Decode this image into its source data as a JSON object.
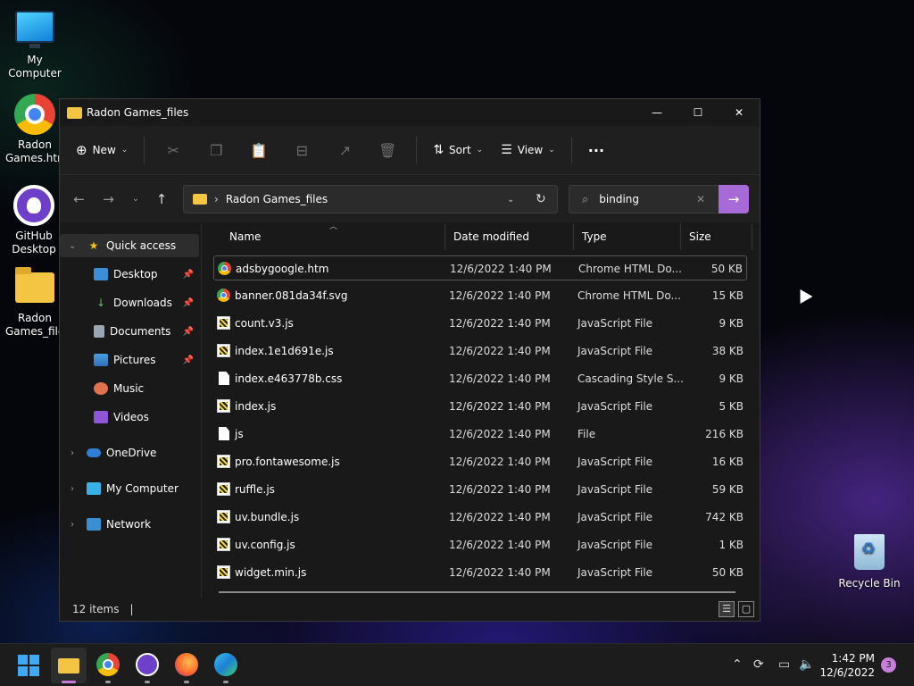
{
  "desktop": {
    "icons": [
      {
        "label": "My Computer"
      },
      {
        "label": "Radon Games.htm"
      },
      {
        "label": "GitHub Desktop"
      },
      {
        "label": "Radon Games_files"
      },
      {
        "label": "Recycle Bin"
      }
    ]
  },
  "window": {
    "title": "Radon Games_files",
    "controls": {
      "minimize": "—",
      "maximize": "☐",
      "close": "✕"
    },
    "toolbar": {
      "new_label": "New",
      "sort_label": "Sort",
      "view_label": "View",
      "more_label": "···"
    },
    "address": {
      "path": "Radon Games_files",
      "separator": "›"
    },
    "search": {
      "value": "binding"
    },
    "sidebar": {
      "quick_access": "Quick access",
      "items": [
        {
          "label": "Desktop",
          "pinned": true
        },
        {
          "label": "Downloads",
          "pinned": true
        },
        {
          "label": "Documents",
          "pinned": true
        },
        {
          "label": "Pictures",
          "pinned": true
        },
        {
          "label": "Music",
          "pinned": false
        },
        {
          "label": "Videos",
          "pinned": false
        }
      ],
      "roots": [
        {
          "label": "OneDrive"
        },
        {
          "label": "My Computer"
        },
        {
          "label": "Network"
        }
      ]
    },
    "columns": {
      "name": "Name",
      "date": "Date modified",
      "type": "Type",
      "size": "Size"
    },
    "files": [
      {
        "name": "adsbygoogle.htm",
        "date": "12/6/2022 1:40 PM",
        "type": "Chrome HTML Do...",
        "size": "50 KB",
        "icon": "chrome"
      },
      {
        "name": "banner.081da34f.svg",
        "date": "12/6/2022 1:40 PM",
        "type": "Chrome HTML Do...",
        "size": "15 KB",
        "icon": "chrome"
      },
      {
        "name": "count.v3.js",
        "date": "12/6/2022 1:40 PM",
        "type": "JavaScript File",
        "size": "9 KB",
        "icon": "js"
      },
      {
        "name": "index.1e1d691e.js",
        "date": "12/6/2022 1:40 PM",
        "type": "JavaScript File",
        "size": "38 KB",
        "icon": "js"
      },
      {
        "name": "index.e463778b.css",
        "date": "12/6/2022 1:40 PM",
        "type": "Cascading Style S...",
        "size": "9 KB",
        "icon": "doc"
      },
      {
        "name": "index.js",
        "date": "12/6/2022 1:40 PM",
        "type": "JavaScript File",
        "size": "5 KB",
        "icon": "js"
      },
      {
        "name": "js",
        "date": "12/6/2022 1:40 PM",
        "type": "File",
        "size": "216 KB",
        "icon": "doc"
      },
      {
        "name": "pro.fontawesome.js",
        "date": "12/6/2022 1:40 PM",
        "type": "JavaScript File",
        "size": "16 KB",
        "icon": "js"
      },
      {
        "name": "ruffle.js",
        "date": "12/6/2022 1:40 PM",
        "type": "JavaScript File",
        "size": "59 KB",
        "icon": "js"
      },
      {
        "name": "uv.bundle.js",
        "date": "12/6/2022 1:40 PM",
        "type": "JavaScript File",
        "size": "742 KB",
        "icon": "js"
      },
      {
        "name": "uv.config.js",
        "date": "12/6/2022 1:40 PM",
        "type": "JavaScript File",
        "size": "1 KB",
        "icon": "js"
      },
      {
        "name": "widget.min.js",
        "date": "12/6/2022 1:40 PM",
        "type": "JavaScript File",
        "size": "50 KB",
        "icon": "js"
      }
    ],
    "status": {
      "item_count": "12 items",
      "caret": "|"
    }
  },
  "taskbar": {
    "clock_time": "1:42 PM",
    "clock_date": "12/6/2022",
    "notification_count": "3"
  },
  "colors": {
    "accent": "#a86ad6",
    "folder": "#f4c542",
    "window_bg": "#191919"
  }
}
